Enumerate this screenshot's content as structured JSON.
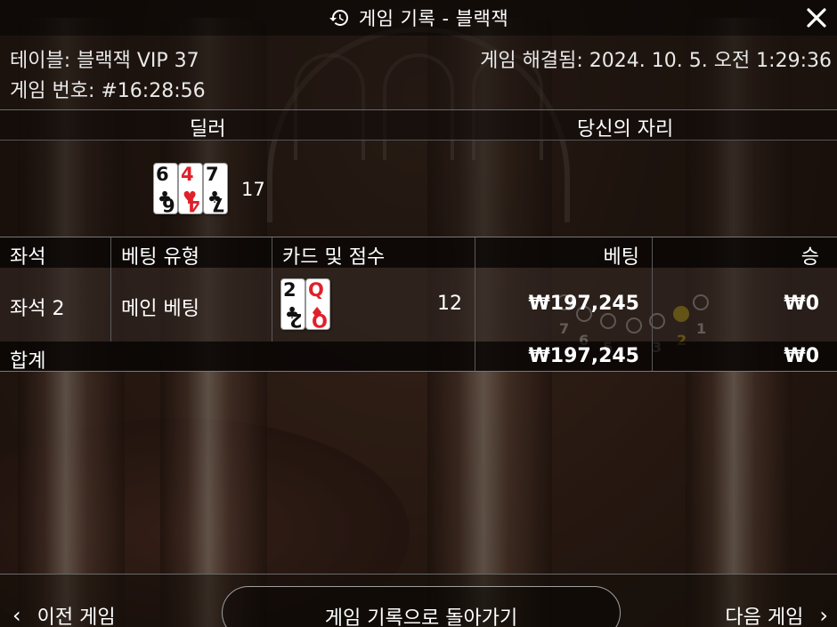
{
  "title": "게임 기록 - 블랙잭",
  "info": {
    "table": "테이블: 블랙잭 VIP 37",
    "game_number": "게임 번호: #16:28:56",
    "resolved": "게임 해결됨: 2024. 10. 5. 오전 1:29:36"
  },
  "dealer_section": {
    "dealer_label": "딜러",
    "seat_label": "당신의 자리",
    "dealer_cards": [
      {
        "rank": "6",
        "suit": "♣",
        "color": "#111111"
      },
      {
        "rank": "4",
        "suit": "♥",
        "color": "#e0202a"
      },
      {
        "rank": "7",
        "suit": "♣",
        "color": "#111111"
      }
    ],
    "dealer_score": "17",
    "seats": [
      "7",
      "6",
      "5",
      "4",
      "3",
      "2",
      "1"
    ],
    "active_seat": "2",
    "active_color": "#f5d000"
  },
  "table": {
    "headers": {
      "seat": "좌석",
      "bet_type": "베팅 유형",
      "cards_score": "카드 및 점수",
      "bet": "베팅",
      "win": "승"
    },
    "row": {
      "seat": "좌석 2",
      "bet_type": "메인 베팅",
      "cards": [
        {
          "rank": "2",
          "suit": "♣",
          "color": "#111111"
        },
        {
          "rank": "Q",
          "suit": "♦",
          "color": "#e0202a"
        }
      ],
      "score": "12",
      "bet": "₩197,245",
      "win": "₩0"
    },
    "total": {
      "label": "합계",
      "bet": "₩197,245",
      "win": "₩0"
    }
  },
  "footer": {
    "prev": "이전 게임",
    "back": "게임 기록으로 돌아가기",
    "next": "다음 게임"
  }
}
